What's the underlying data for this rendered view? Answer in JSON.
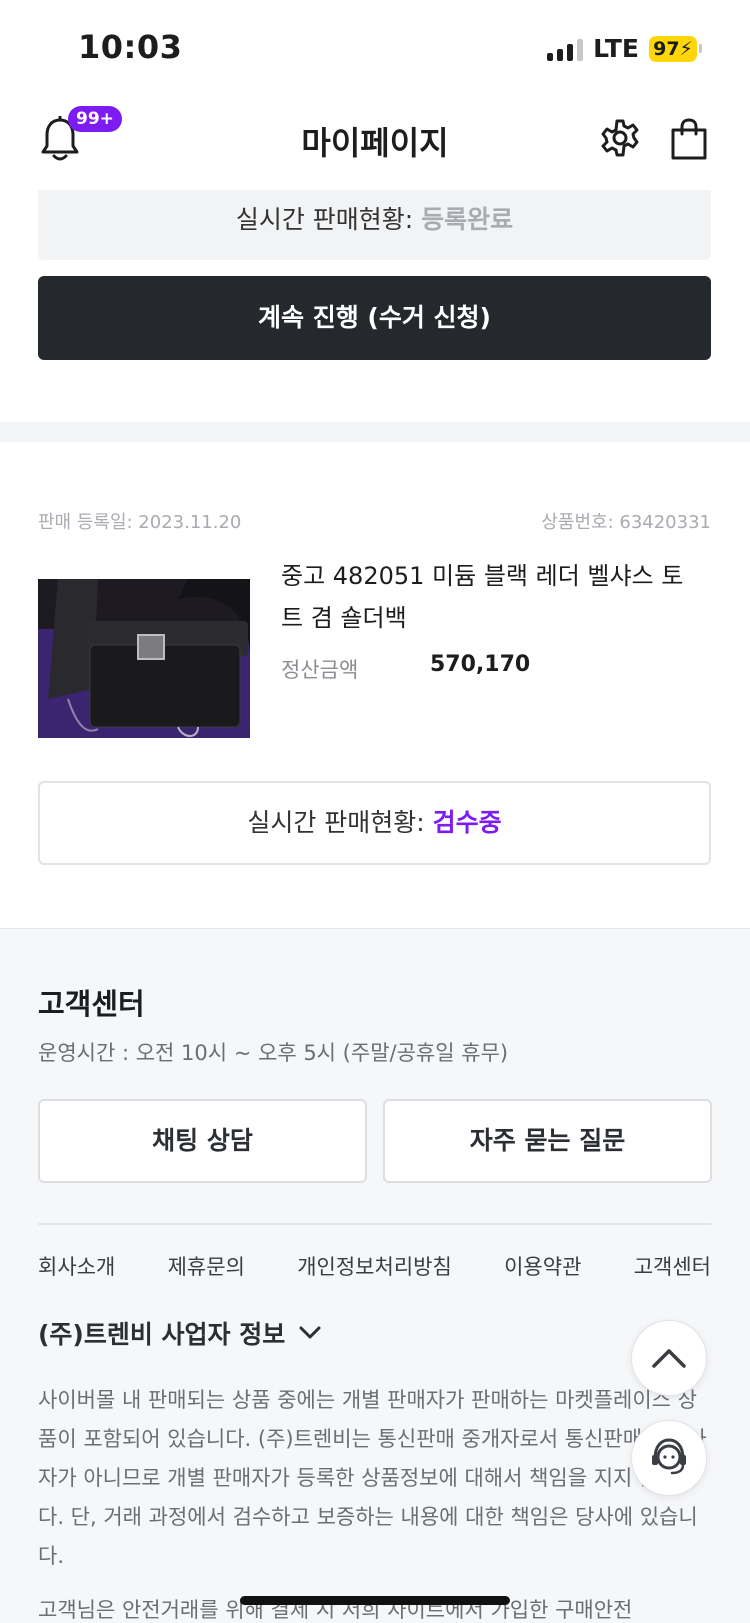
{
  "status_bar": {
    "time": "10:03",
    "network": "LTE",
    "battery": "97"
  },
  "header": {
    "title": "마이페이지",
    "badge": "99+"
  },
  "sale_prev": {
    "status_label": "실시간 판매현황: ",
    "status_value": "등록완료",
    "action_button": "계속 진행 (수거 신청)"
  },
  "sale_item": {
    "registered": "판매 등록일: 2023.11.20",
    "product_no": "상품번호: 63420331",
    "product_name": "중고 482051 미듐 블랙 레더 벨샤스 토트 겸 숄더백",
    "price_label": "정산금액",
    "price_value": "570,170",
    "status_label": "실시간 판매현황: ",
    "status_value": "검수중"
  },
  "customer_center": {
    "title": "고객센터",
    "hours": "운영시간 : 오전 10시 ~ 오후 5시 (주말/공휴일 휴무)",
    "chat_button": "채팅 상담",
    "faq_button": "자주 묻는 질문"
  },
  "footer_links": [
    "회사소개",
    "제휴문의",
    "개인정보처리방침",
    "이용약관",
    "고객센터"
  ],
  "business_info_toggle": "(주)트렌비 사업자 정보",
  "disclaimer": "사이버몰 내 판매되는 상품 중에는 개별 판매자가 판매하는 마켓플레이스 상품이 포함되어 있습니다. (주)트렌비는 통신판매 중개자로서 통신판매의 당사자가 아니므로 개별 판매자가 등록한 상품정보에 대해서 책임을 지지 않습니다. 단, 거래 과정에서 검수하고 보증하는 내용에 대한 책임은 당사에 있습니다.",
  "disclaimer2": "고객님은 안전거래를 위해 결제 시 저희 사이트에서 가입한 구매안전",
  "colors": {
    "accent": "#7c1cf0",
    "dark_button": "#25282d",
    "muted": "#a8abb0"
  }
}
